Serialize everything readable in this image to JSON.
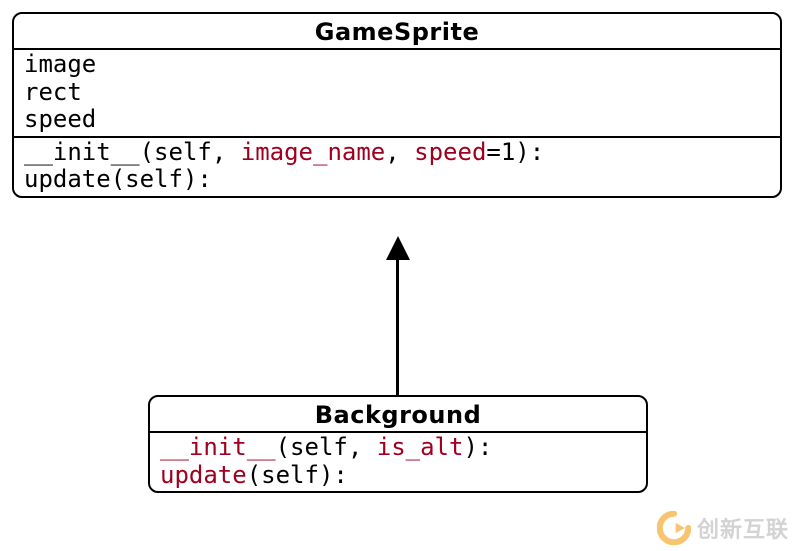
{
  "classes": {
    "gamesprite": {
      "name": "GameSprite",
      "attributes": [
        "image",
        "rect",
        "speed"
      ],
      "methods": {
        "init": {
          "name": "__init__",
          "self": "self",
          "p1": "image_name",
          "p2": "speed",
          "p2_default": "=1):",
          "sep1": "(",
          "sep2": ", ",
          "sep3": ", "
        },
        "update": {
          "name": "update",
          "sig_rest": "(self):"
        }
      }
    },
    "background": {
      "name": "Background",
      "methods": {
        "init": {
          "name": "__init__",
          "self": "self",
          "p1": "is_alt",
          "sep1": "(",
          "sep2": ", ",
          "close": "):"
        },
        "update": {
          "name": "update",
          "sig_rest": "(self):"
        }
      }
    }
  },
  "watermark": {
    "text": "创新互联"
  }
}
